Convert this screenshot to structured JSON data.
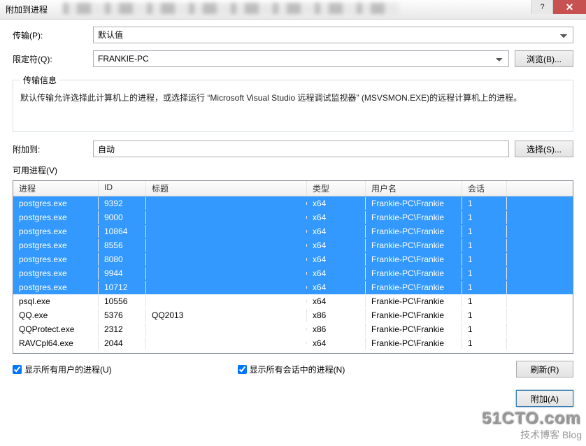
{
  "title": "附加到进程",
  "transport": {
    "label": "传输(P):",
    "value": "默认值"
  },
  "qualifier": {
    "label": "限定符(Q):",
    "value": "FRANKIE-PC",
    "browse": "浏览(B)..."
  },
  "transport_info": {
    "legend": "传输信息",
    "text": "默认传输允许选择此计算机上的进程，或选择运行 “Microsoft Visual Studio 远程调试监视器” (MSVSMON.EXE)的远程计算机上的进程。"
  },
  "attach_to": {
    "label": "附加到:",
    "value": "自动",
    "select_btn": "选择(S)..."
  },
  "available": {
    "label": "可用进程(V)",
    "columns": {
      "proc": "进程",
      "id": "ID",
      "title": "标题",
      "type": "类型",
      "user": "用户名",
      "session": "会话"
    },
    "rows": [
      {
        "proc": "postgres.exe",
        "id": "9392",
        "title": "",
        "type": "x64",
        "user": "Frankie-PC\\Frankie",
        "session": "1",
        "sel": true
      },
      {
        "proc": "postgres.exe",
        "id": "9000",
        "title": "",
        "type": "x64",
        "user": "Frankie-PC\\Frankie",
        "session": "1",
        "sel": true
      },
      {
        "proc": "postgres.exe",
        "id": "10864",
        "title": "",
        "type": "x64",
        "user": "Frankie-PC\\Frankie",
        "session": "1",
        "sel": true
      },
      {
        "proc": "postgres.exe",
        "id": "8556",
        "title": "",
        "type": "x64",
        "user": "Frankie-PC\\Frankie",
        "session": "1",
        "sel": true
      },
      {
        "proc": "postgres.exe",
        "id": "8080",
        "title": "",
        "type": "x64",
        "user": "Frankie-PC\\Frankie",
        "session": "1",
        "sel": true
      },
      {
        "proc": "postgres.exe",
        "id": "9944",
        "title": "",
        "type": "x64",
        "user": "Frankie-PC\\Frankie",
        "session": "1",
        "sel": true
      },
      {
        "proc": "postgres.exe",
        "id": "10712",
        "title": "",
        "type": "x64",
        "user": "Frankie-PC\\Frankie",
        "session": "1",
        "sel": true
      },
      {
        "proc": "psql.exe",
        "id": "10556",
        "title": "",
        "type": "x64",
        "user": "Frankie-PC\\Frankie",
        "session": "1",
        "sel": false
      },
      {
        "proc": "QQ.exe",
        "id": "5376",
        "title": "QQ2013",
        "type": "x86",
        "user": "Frankie-PC\\Frankie",
        "session": "1",
        "sel": false
      },
      {
        "proc": "QQProtect.exe",
        "id": "2312",
        "title": "",
        "type": "x86",
        "user": "Frankie-PC\\Frankie",
        "session": "1",
        "sel": false
      },
      {
        "proc": "RAVCpl64.exe",
        "id": "2044",
        "title": "",
        "type": "x64",
        "user": "Frankie-PC\\Frankie",
        "session": "1",
        "sel": false
      }
    ],
    "show_all_users": "显示所有用户的进程(U)",
    "show_all_sessions": "显示所有会话中的进程(N)",
    "refresh": "刷新(R)"
  },
  "footer": {
    "attach": "附加(A)"
  },
  "watermark": {
    "big": "51CTO.com",
    "small": "技术博客  Blog"
  }
}
